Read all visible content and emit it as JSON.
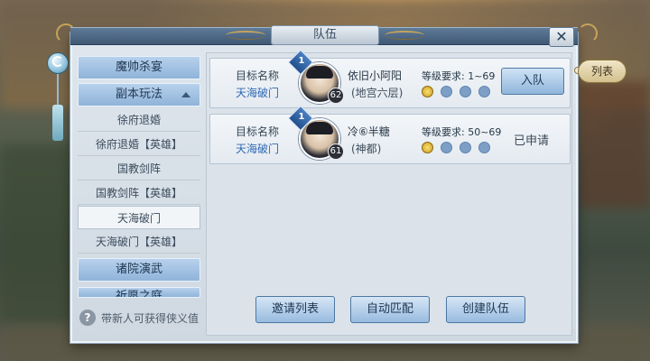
{
  "window": {
    "title": "队伍",
    "close_symbol": "✕"
  },
  "side_tab": {
    "label": "列表"
  },
  "sidebar": {
    "categories": [
      {
        "label": "魔帅杀宴"
      },
      {
        "label": "副本玩法",
        "expanded": true
      },
      {
        "label": "诸院演武"
      },
      {
        "label": "祈愿之庭"
      }
    ],
    "subitems": [
      {
        "label": "徐府退婚"
      },
      {
        "label": "徐府退婚【英雄】"
      },
      {
        "label": "国教剑阵"
      },
      {
        "label": "国教剑阵【英雄】"
      },
      {
        "label": "天海破门",
        "selected": true
      },
      {
        "label": "天海破门【英雄】"
      }
    ],
    "help_symbol": "?",
    "help_text": "带新人可获得侠义值"
  },
  "teams": [
    {
      "target_label": "目标名称",
      "target_value": "天海破门",
      "leader_icon": "1",
      "level": "62",
      "name": "依旧小阿阳",
      "location": "(地宫六层)",
      "level_req": "等级要求: 1~69",
      "members_filled": 1,
      "members_total": 4,
      "action": "入队",
      "action_type": "button"
    },
    {
      "target_label": "目标名称",
      "target_value": "天海破门",
      "leader_icon": "1",
      "level": "61",
      "name": "冷⑥半糖",
      "location": "(神都)",
      "level_req": "等级要求: 50~69",
      "members_filled": 1,
      "members_total": 4,
      "action": "已申请",
      "action_type": "status"
    }
  ],
  "footer_buttons": {
    "invite": "邀请列表",
    "auto_match": "自动匹配",
    "create": "创建队伍"
  },
  "colors": {
    "accent_blue": "#2f69b5",
    "slot_filled": "#e0b73c",
    "slot_empty": "#7d9fc6"
  }
}
